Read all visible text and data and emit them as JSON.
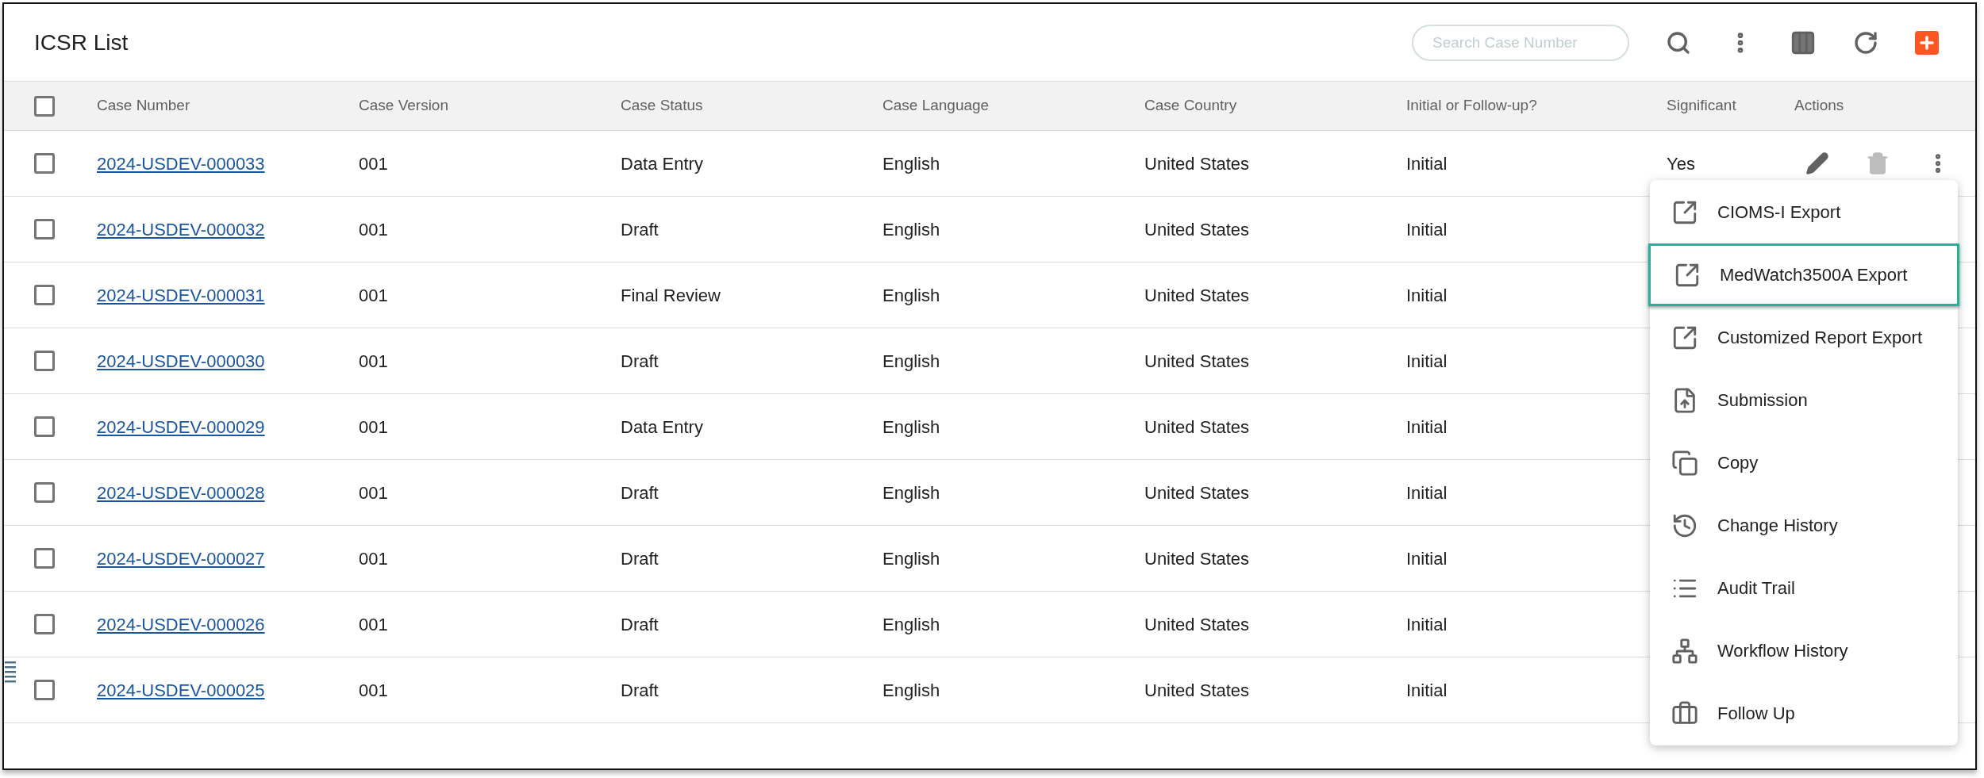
{
  "title": "ICSR List",
  "search": {
    "placeholder": "Search Case Number"
  },
  "table": {
    "select_all": {
      "checked": false
    },
    "columns": [
      "Case Number",
      "Case Version",
      "Case Status",
      "Case Language",
      "Case Country",
      "Initial or Follow-up?",
      "Significant",
      "Actions"
    ],
    "rows": [
      {
        "checked": false,
        "case_number": "2024-USDEV-000033",
        "version": "001",
        "status": "Data Entry",
        "language": "English",
        "country": "United States",
        "initial": "Initial",
        "significant": "Yes",
        "actions": true
      },
      {
        "checked": false,
        "case_number": "2024-USDEV-000032",
        "version": "001",
        "status": "Draft",
        "language": "English",
        "country": "United States",
        "initial": "Initial"
      },
      {
        "checked": false,
        "case_number": "2024-USDEV-000031",
        "version": "001",
        "status": "Final Review",
        "language": "English",
        "country": "United States",
        "initial": "Initial"
      },
      {
        "checked": false,
        "case_number": "2024-USDEV-000030",
        "version": "001",
        "status": "Draft",
        "language": "English",
        "country": "United States",
        "initial": "Initial"
      },
      {
        "checked": false,
        "case_number": "2024-USDEV-000029",
        "version": "001",
        "status": "Data Entry",
        "language": "English",
        "country": "United States",
        "initial": "Initial"
      },
      {
        "checked": false,
        "case_number": "2024-USDEV-000028",
        "version": "001",
        "status": "Draft",
        "language": "English",
        "country": "United States",
        "initial": "Initial"
      },
      {
        "checked": false,
        "case_number": "2024-USDEV-000027",
        "version": "001",
        "status": "Draft",
        "language": "English",
        "country": "United States",
        "initial": "Initial"
      },
      {
        "checked": false,
        "case_number": "2024-USDEV-000026",
        "version": "001",
        "status": "Draft",
        "language": "English",
        "country": "United States",
        "initial": "Initial"
      },
      {
        "checked": false,
        "case_number": "2024-USDEV-000025",
        "version": "001",
        "status": "Draft",
        "language": "English",
        "country": "United States",
        "initial": "Initial"
      }
    ]
  },
  "menu": [
    {
      "label": "CIOMS-I Export",
      "selected": false
    },
    {
      "label": "MedWatch3500A Export",
      "selected": true
    },
    {
      "label": "Customized Report Export",
      "selected": false
    },
    {
      "label": "Submission",
      "selected": false
    },
    {
      "label": "Copy",
      "selected": false
    },
    {
      "label": "Change History",
      "selected": false
    },
    {
      "label": "Audit Trail",
      "selected": false
    },
    {
      "label": "Workflow History",
      "selected": false
    },
    {
      "label": "Follow Up",
      "selected": false
    }
  ]
}
